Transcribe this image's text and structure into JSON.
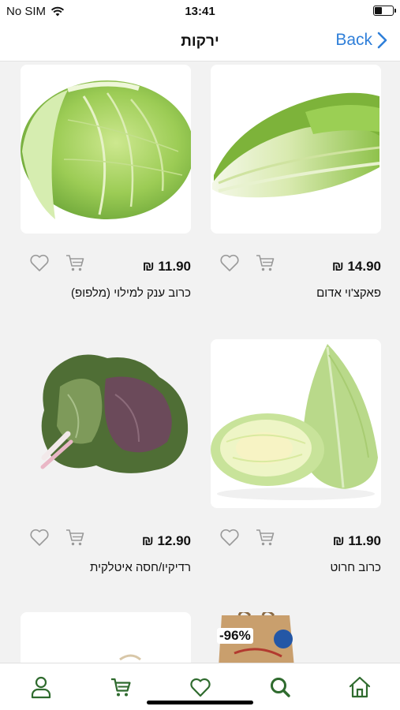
{
  "status_bar": {
    "carrier": "No SIM",
    "time": "13:41"
  },
  "nav": {
    "title": "ירקות",
    "back_label": "Back"
  },
  "currency": "₪",
  "products": [
    {
      "name": "פאקצ'וי  אדום",
      "price": "14.90 ₪",
      "image": "bok-choy"
    },
    {
      "name": "כרוב ענק למילוי    (מלפופ)",
      "price": "11.90 ₪",
      "image": "cabbage"
    },
    {
      "name": "כרוב חרוט",
      "price": "11.90 ₪",
      "image": "pointed-cabbage"
    },
    {
      "name": "רדיקיו/חסה איטלקית",
      "price": "12.90 ₪",
      "image": "radicchio"
    }
  ],
  "partial_products": [
    {
      "discount": "-96%",
      "image": "paper-bag"
    },
    {
      "image": "blank"
    }
  ],
  "tab_bar": [
    "home-icon",
    "search-icon",
    "heart-icon",
    "cart-icon",
    "user-icon"
  ],
  "colors": {
    "accent_green": "#2f6b2e",
    "back_blue": "#2f7fd9",
    "background": "#f2f2f2"
  }
}
